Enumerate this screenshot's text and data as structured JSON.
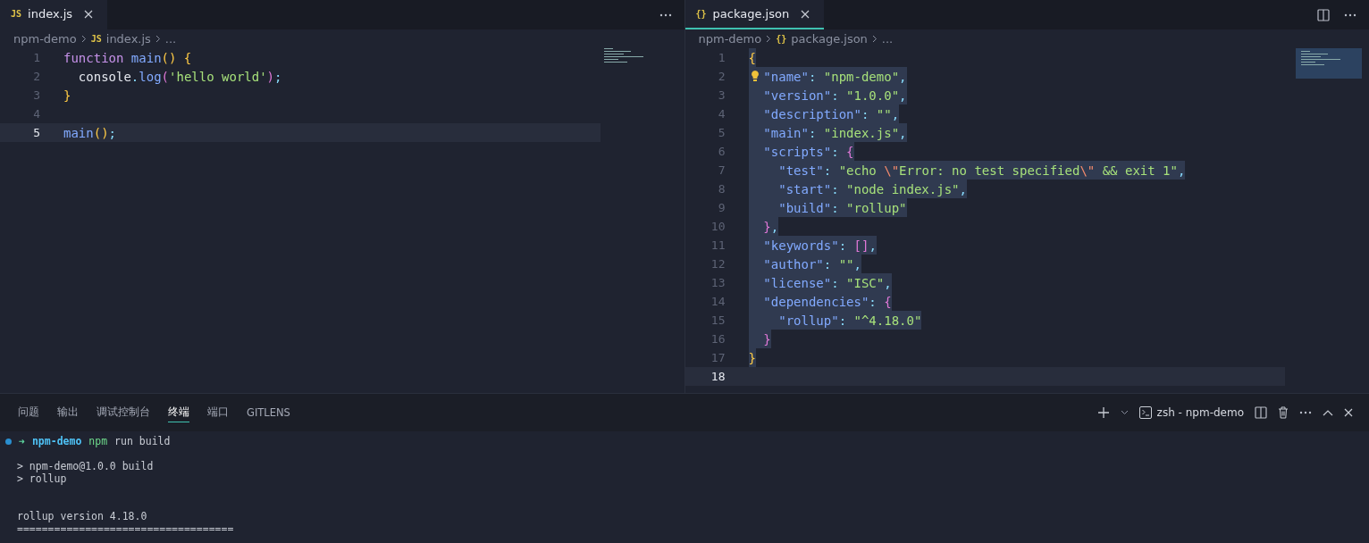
{
  "editors": [
    {
      "tab": {
        "icon_text": "JS",
        "label": "index.js",
        "focused": false
      },
      "show_split": false,
      "breadcrumb": [
        {
          "text": "npm-demo"
        },
        {
          "text": "index.js",
          "icon_text": "JS"
        },
        {
          "text": "..."
        }
      ],
      "lines": [
        {
          "number": "1",
          "current": false,
          "selected": false,
          "tokens": [
            {
              "text": "function ",
              "kind": "keyword"
            },
            {
              "text": "main",
              "kind": "fn"
            },
            {
              "text": "() {",
              "kind": "brace"
            }
          ]
        },
        {
          "number": "2",
          "current": false,
          "selected": false,
          "tokens": [
            {
              "text": "  console",
              "kind": "plain"
            },
            {
              "text": ".",
              "kind": "punct"
            },
            {
              "text": "log",
              "kind": "fn"
            },
            {
              "text": "(",
              "kind": "brace2"
            },
            {
              "text": "'hello world'",
              "kind": "string"
            },
            {
              "text": ")",
              "kind": "brace2"
            },
            {
              "text": ";",
              "kind": "punct"
            }
          ]
        },
        {
          "number": "3",
          "current": false,
          "selected": false,
          "tokens": [
            {
              "text": "}",
              "kind": "brace"
            }
          ]
        },
        {
          "number": "4",
          "current": false
        },
        {
          "number": "5",
          "current": true,
          "selected": false,
          "tokens": [
            {
              "text": "main",
              "kind": "fn"
            },
            {
              "text": "()",
              "kind": "brace"
            },
            {
              "text": ";",
              "kind": "punct"
            }
          ]
        }
      ]
    },
    {
      "tab": {
        "icon_text": "{}",
        "label": "package.json",
        "focused": true
      },
      "show_split": true,
      "breadcrumb": [
        {
          "text": "npm-demo"
        },
        {
          "text": "package.json",
          "icon_text": "{}"
        },
        {
          "text": "..."
        }
      ],
      "lines": [
        {
          "number": "1",
          "current": false,
          "selected": true,
          "tokens": [
            {
              "text": "{",
              "kind": "brace"
            }
          ]
        },
        {
          "number": "2",
          "current": false,
          "selected": true,
          "lightbulb": true,
          "tokens": [
            {
              "text": "  \"name\"",
              "kind": "prop"
            },
            {
              "text": ": ",
              "kind": "punct"
            },
            {
              "text": "\"npm-demo\"",
              "kind": "string"
            },
            {
              "text": ",",
              "kind": "punct"
            }
          ]
        },
        {
          "number": "3",
          "current": false,
          "selected": true,
          "tokens": [
            {
              "text": "  \"version\"",
              "kind": "prop"
            },
            {
              "text": ": ",
              "kind": "punct"
            },
            {
              "text": "\"1.0.0\"",
              "kind": "string"
            },
            {
              "text": ",",
              "kind": "punct"
            }
          ]
        },
        {
          "number": "4",
          "current": false,
          "selected": true,
          "tokens": [
            {
              "text": "  \"description\"",
              "kind": "prop"
            },
            {
              "text": ": ",
              "kind": "punct"
            },
            {
              "text": "\"\"",
              "kind": "string"
            },
            {
              "text": ",",
              "kind": "punct"
            }
          ]
        },
        {
          "number": "5",
          "current": false,
          "selected": true,
          "tokens": [
            {
              "text": "  \"main\"",
              "kind": "prop"
            },
            {
              "text": ": ",
              "kind": "punct"
            },
            {
              "text": "\"index.js\"",
              "kind": "string"
            },
            {
              "text": ",",
              "kind": "punct"
            }
          ]
        },
        {
          "number": "6",
          "current": false,
          "selected": true,
          "tokens": [
            {
              "text": "  \"scripts\"",
              "kind": "prop"
            },
            {
              "text": ": ",
              "kind": "punct"
            },
            {
              "text": "{",
              "kind": "brace2"
            }
          ]
        },
        {
          "number": "7",
          "current": false,
          "selected": true,
          "tokens": [
            {
              "text": "    \"test\"",
              "kind": "prop"
            },
            {
              "text": ": ",
              "kind": "punct"
            },
            {
              "text": "\"echo ",
              "kind": "string"
            },
            {
              "text": "\\\"",
              "kind": "escape"
            },
            {
              "text": "Error: no test specified",
              "kind": "string"
            },
            {
              "text": "\\\"",
              "kind": "escape"
            },
            {
              "text": " && exit 1\"",
              "kind": "string"
            },
            {
              "text": ",",
              "kind": "punct"
            }
          ]
        },
        {
          "number": "8",
          "current": false,
          "selected": true,
          "tokens": [
            {
              "text": "    \"start\"",
              "kind": "prop"
            },
            {
              "text": ": ",
              "kind": "punct"
            },
            {
              "text": "\"node index.js\"",
              "kind": "string"
            },
            {
              "text": ",",
              "kind": "punct"
            }
          ]
        },
        {
          "number": "9",
          "current": false,
          "selected": true,
          "tokens": [
            {
              "text": "    \"build\"",
              "kind": "prop"
            },
            {
              "text": ": ",
              "kind": "punct"
            },
            {
              "text": "\"rollup\"",
              "kind": "string"
            }
          ]
        },
        {
          "number": "10",
          "current": false,
          "selected": true,
          "tokens": [
            {
              "text": "  }",
              "kind": "brace2"
            },
            {
              "text": ",",
              "kind": "punct"
            }
          ]
        },
        {
          "number": "11",
          "current": false,
          "selected": true,
          "tokens": [
            {
              "text": "  \"keywords\"",
              "kind": "prop"
            },
            {
              "text": ": ",
              "kind": "punct"
            },
            {
              "text": "[]",
              "kind": "brace2"
            },
            {
              "text": ",",
              "kind": "punct"
            }
          ]
        },
        {
          "number": "12",
          "current": false,
          "selected": true,
          "tokens": [
            {
              "text": "  \"author\"",
              "kind": "prop"
            },
            {
              "text": ": ",
              "kind": "punct"
            },
            {
              "text": "\"\"",
              "kind": "string"
            },
            {
              "text": ",",
              "kind": "punct"
            }
          ]
        },
        {
          "number": "13",
          "current": false,
          "selected": true,
          "tokens": [
            {
              "text": "  \"license\"",
              "kind": "prop"
            },
            {
              "text": ": ",
              "kind": "punct"
            },
            {
              "text": "\"ISC\"",
              "kind": "string"
            },
            {
              "text": ",",
              "kind": "punct"
            }
          ]
        },
        {
          "number": "14",
          "current": false,
          "selected": true,
          "tokens": [
            {
              "text": "  \"dependencies\"",
              "kind": "prop"
            },
            {
              "text": ": ",
              "kind": "punct"
            },
            {
              "text": "{",
              "kind": "brace2"
            }
          ]
        },
        {
          "number": "15",
          "current": false,
          "selected": true,
          "tokens": [
            {
              "text": "    \"rollup\"",
              "kind": "prop"
            },
            {
              "text": ": ",
              "kind": "punct"
            },
            {
              "text": "\"^4.18.0\"",
              "kind": "string"
            }
          ]
        },
        {
          "number": "16",
          "current": false,
          "selected": true,
          "tokens": [
            {
              "text": "  }",
              "kind": "brace2"
            }
          ]
        },
        {
          "number": "17",
          "current": false,
          "selected": true,
          "tokens": [
            {
              "text": "}",
              "kind": "brace"
            }
          ]
        },
        {
          "number": "18",
          "current": true
        }
      ]
    }
  ],
  "panel": {
    "tabs": [
      {
        "label": "问题",
        "selected": false
      },
      {
        "label": "输出",
        "selected": false
      },
      {
        "label": "调试控制台",
        "selected": false
      },
      {
        "label": "终端",
        "selected": true
      },
      {
        "label": "端口",
        "selected": false
      },
      {
        "label": "GITLENS",
        "selected": false
      }
    ],
    "terminal_title": "zsh - npm-demo",
    "terminal_lines": [
      {
        "kind": "command",
        "tokens": [
          {
            "text": "➜",
            "kind": "arrow"
          },
          {
            "text": "npm-demo",
            "kind": "dir"
          },
          {
            "text": "npm",
            "kind": "cmd"
          },
          {
            "text": "run build",
            "kind": "plain"
          }
        ]
      },
      {
        "kind": "blank"
      },
      {
        "kind": "output",
        "text": "> npm-demo@1.0.0 build"
      },
      {
        "kind": "output",
        "text": "> rollup"
      },
      {
        "kind": "blank"
      },
      {
        "kind": "blank"
      },
      {
        "kind": "output",
        "text": "rollup version 4.18.0"
      },
      {
        "kind": "output",
        "text": "==================================="
      }
    ]
  }
}
